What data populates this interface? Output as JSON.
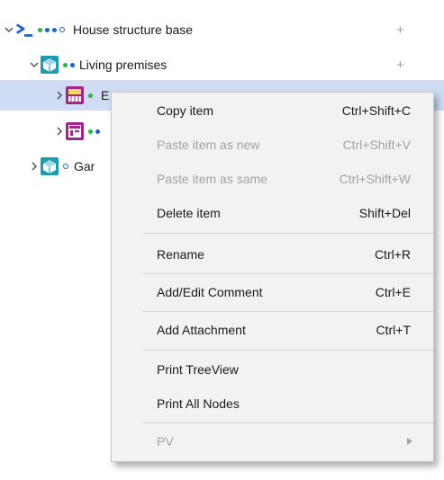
{
  "tree": {
    "rows": [
      {
        "label": "House structure base",
        "plus": "+"
      },
      {
        "label": "Living premises",
        "plus": "+"
      },
      {
        "label": "E"
      },
      {
        "label": ""
      },
      {
        "label": "Gar"
      }
    ]
  },
  "menu": {
    "items": [
      {
        "label": "Copy item",
        "shortcut": "Ctrl+Shift+C",
        "enabled": true
      },
      {
        "label": "Paste item as new",
        "shortcut": "Ctrl+Shift+V",
        "enabled": false
      },
      {
        "label": "Paste item as same",
        "shortcut": "Ctrl+Shift+W",
        "enabled": false
      },
      {
        "label": "Delete item",
        "shortcut": "Shift+Del",
        "enabled": true
      },
      {
        "label": "Rename",
        "shortcut": "Ctrl+R",
        "enabled": true
      },
      {
        "label": "Add/Edit Comment",
        "shortcut": "Ctrl+E",
        "enabled": true
      },
      {
        "label": "Add Attachment",
        "shortcut": "Ctrl+T",
        "enabled": true
      },
      {
        "label": "Print TreeView",
        "shortcut": "",
        "enabled": true
      },
      {
        "label": "Print All Nodes",
        "shortcut": "",
        "enabled": true
      },
      {
        "label": "PV",
        "shortcut": "",
        "enabled": false
      }
    ]
  },
  "colors": {
    "accent_blue": "#1f5fd1",
    "dot_green": "#2bb24c",
    "dot_blue": "#1f5fd1",
    "node_magenta": "#a3258c",
    "node_teal": "#1f9bb0",
    "selection": "#cfdcf3"
  }
}
